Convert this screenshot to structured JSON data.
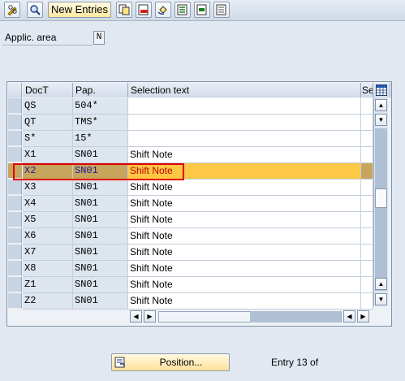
{
  "toolbar": {
    "buttons": [
      "edit-glasses-icon",
      "display-icon",
      "copy-icon",
      "delete-icon",
      "undo-icon",
      "select-all-icon",
      "select-block-icon",
      "deselect-all-icon"
    ],
    "new_entries_label": "New Entries"
  },
  "applic_area": {
    "label": "Applic. area",
    "value": "N"
  },
  "table": {
    "headers": [
      "DocT",
      "Pap.",
      "Selection text",
      "Se"
    ],
    "rows": [
      {
        "doct": "QS",
        "pap": "504*",
        "text": ""
      },
      {
        "doct": "QT",
        "pap": "TMS*",
        "text": ""
      },
      {
        "doct": "S*",
        "pap": "15*",
        "text": ""
      },
      {
        "doct": "X1",
        "pap": "SN01",
        "text": "Shift Note"
      },
      {
        "doct": "X2",
        "pap": "SN01",
        "text": "Shift Note",
        "selected": true
      },
      {
        "doct": "X3",
        "pap": "SN01",
        "text": "Shift Note"
      },
      {
        "doct": "X4",
        "pap": "SN01",
        "text": "Shift Note"
      },
      {
        "doct": "X5",
        "pap": "SN01",
        "text": "Shift Note"
      },
      {
        "doct": "X6",
        "pap": "SN01",
        "text": "Shift Note"
      },
      {
        "doct": "X7",
        "pap": "SN01",
        "text": "Shift Note"
      },
      {
        "doct": "X8",
        "pap": "SN01",
        "text": "Shift Note"
      },
      {
        "doct": "Z1",
        "pap": "SN01",
        "text": "Shift Note"
      },
      {
        "doct": "Z2",
        "pap": "SN01",
        "text": "Shift Note"
      }
    ]
  },
  "footer": {
    "position_label": "Position...",
    "entry_text": "Entry 13 of"
  },
  "colors": {
    "selected_row": "#fcc846",
    "selected_key": "#c8a55c",
    "highlight_border": "#e00000"
  }
}
